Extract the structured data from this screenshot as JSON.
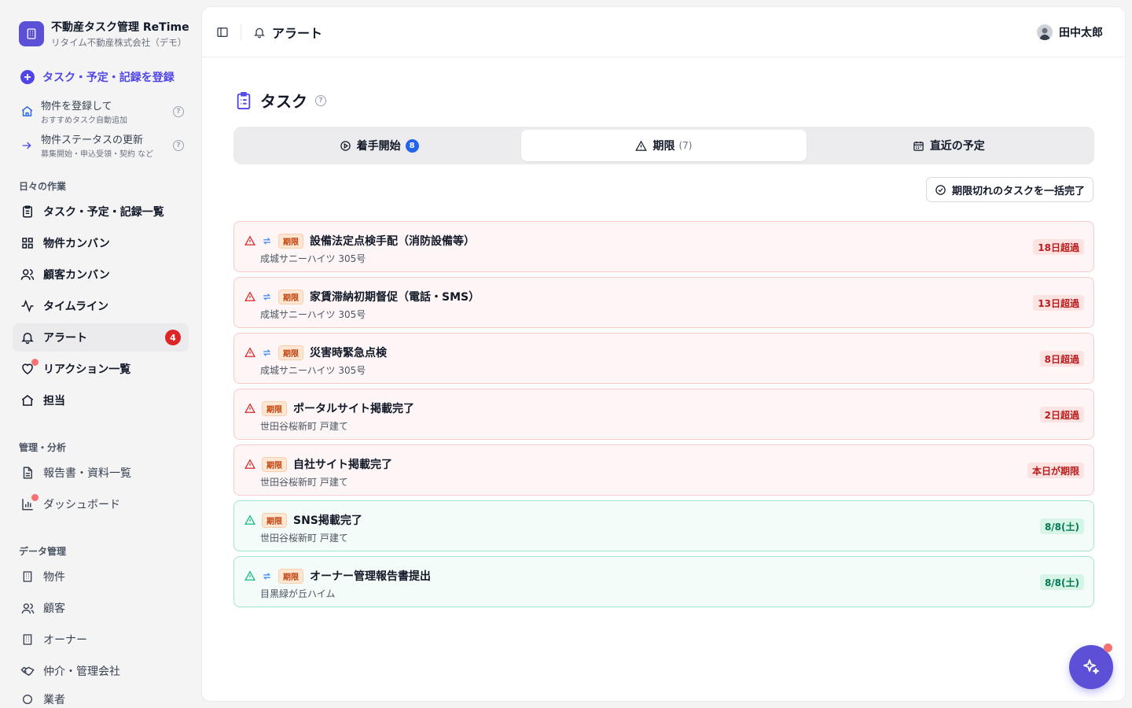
{
  "brand": {
    "title": "不動産タスク管理 ReTime",
    "subtitle": "リタイム不動産株式会社（デモ）"
  },
  "register": {
    "label": "タスク・予定・記録を登録"
  },
  "quick_actions": [
    {
      "title": "物件を登録して",
      "subtitle": "おすすめタスク自動追加"
    },
    {
      "title": "物件ステータスの更新",
      "subtitle": "募集開始・申込受領・契約 など"
    }
  ],
  "sections": {
    "daily": "日々の作業",
    "manage": "管理・分析",
    "data": "データ管理"
  },
  "nav_daily": [
    {
      "label": "タスク・予定・記録一覧"
    },
    {
      "label": "物件カンバン"
    },
    {
      "label": "顧客カンバン"
    },
    {
      "label": "タイムライン"
    },
    {
      "label": "アラート",
      "badge": "4"
    },
    {
      "label": "リアクション一覧"
    },
    {
      "label": "担当"
    }
  ],
  "nav_manage": [
    {
      "label": "報告書・資料一覧"
    },
    {
      "label": "ダッシュボード"
    }
  ],
  "nav_data": [
    {
      "label": "物件"
    },
    {
      "label": "顧客"
    },
    {
      "label": "オーナー"
    },
    {
      "label": "仲介・管理会社"
    },
    {
      "label": "業者"
    }
  ],
  "header": {
    "crumb": "アラート",
    "user": "田中太郎"
  },
  "page": {
    "title": "タスク"
  },
  "tabs": [
    {
      "label": "着手開始",
      "count": "8"
    },
    {
      "label": "期限",
      "count": "(7)"
    },
    {
      "label": "直近の予定"
    }
  ],
  "bulk_button": "期限切れのタスクを一括完了",
  "tag_label": "期限",
  "tasks": [
    {
      "title": "設備法定点検手配（消防設備等）",
      "property": "成城サニーハイツ 305号",
      "status": "18日超過"
    },
    {
      "title": "家賃滞納初期督促（電話・SMS）",
      "property": "成城サニーハイツ 305号",
      "status": "13日超過"
    },
    {
      "title": "災害時緊急点検",
      "property": "成城サニーハイツ 305号",
      "status": "8日超過"
    },
    {
      "title": "ポータルサイト掲載完了",
      "property": "世田谷桜新町 戸建て",
      "status": "2日超過"
    },
    {
      "title": "自社サイト掲載完了",
      "property": "世田谷桜新町 戸建て",
      "status": "本日が期限"
    },
    {
      "title": "SNS掲載完了",
      "property": "世田谷桜新町 戸建て",
      "status": "8/8(土)"
    },
    {
      "title": "オーナー管理報告書提出",
      "property": "目黒緑が丘ハイム",
      "status": "8/8(土)"
    }
  ],
  "colors": {
    "accent": "#4f46e5",
    "overdue": "#dc2626",
    "upcoming": "#10b981"
  }
}
